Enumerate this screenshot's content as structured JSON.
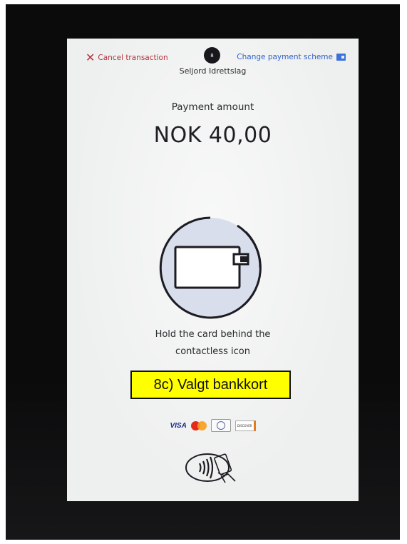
{
  "terminal": {
    "cancel_label": "Cancel transaction",
    "step_badge": "8",
    "merchant_name": "Seljord Idrettslag",
    "change_scheme_label": "Change payment scheme",
    "amount_label": "Payment amount",
    "amount_value": "NOK 40,00",
    "instruction_line1": "Hold the card behind the",
    "instruction_line2": "contactless icon"
  },
  "annotation": {
    "caption": "8c) Valgt bankkort"
  },
  "brands": {
    "visa": "VISA",
    "discover": "DISCOVER"
  },
  "icons": {
    "cancel": "close-icon",
    "scheme": "wallet-icon",
    "card": "card-icon",
    "contactless": "contactless-icon"
  },
  "colors": {
    "cancel": "#b5303b",
    "link": "#2e60c9",
    "highlight": "#ffff00",
    "screen_bg": "#eef0ef",
    "circle_fill": "#d9deec"
  }
}
